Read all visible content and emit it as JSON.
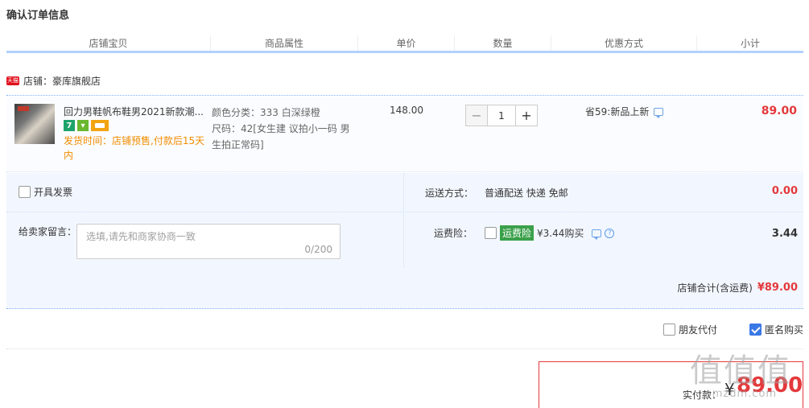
{
  "page_title": "确认订单信息",
  "columns": [
    "店铺宝贝",
    "商品属性",
    "单价",
    "数量",
    "优惠方式",
    "小计"
  ],
  "shop": {
    "badge": "天猫",
    "label": "店铺：豪库旗舰店"
  },
  "item": {
    "name": "回力男鞋帆布鞋男2021新款潮...",
    "shipping_time": "发货时间：店铺预售,付款后15天内",
    "attr_color": "颜色分类：333 白深绿橙",
    "attr_size": "尺码：42[女生建 议拍小一码 男生拍正常码]",
    "unit_price": "148.00",
    "quantity": "1",
    "promo": "省59:新品上新",
    "subtotal": "89.00",
    "icon_badge": "7"
  },
  "invoice": {
    "label": "开具发票"
  },
  "message": {
    "label": "给卖家留言：",
    "placeholder": "选填,请先和商家协商一致",
    "counter": "0/200"
  },
  "shipping": {
    "label": "运送方式：",
    "value": "普通配送 快递 免邮",
    "fee": "0.00"
  },
  "insurance": {
    "label": "运费险：",
    "tag": "运费险",
    "text": "¥3.44购买",
    "fee": "3.44"
  },
  "shop_total": {
    "label": "店铺合计(含运费)",
    "amount": "¥89.00"
  },
  "options": {
    "friend_pay": "朋友代付",
    "anonymous": "匿名购买",
    "anonymous_checked": true
  },
  "pay": {
    "label": "实付款：",
    "currency": "¥",
    "amount": "89.00"
  },
  "watermark": {
    "chars": "值值值",
    "site": "smzdm.com"
  },
  "colors": {
    "accent_red": "#e4393c",
    "header_blue": "#b2d1ff",
    "panel_bg": "#f2f7ff",
    "orange": "#f18d00"
  }
}
